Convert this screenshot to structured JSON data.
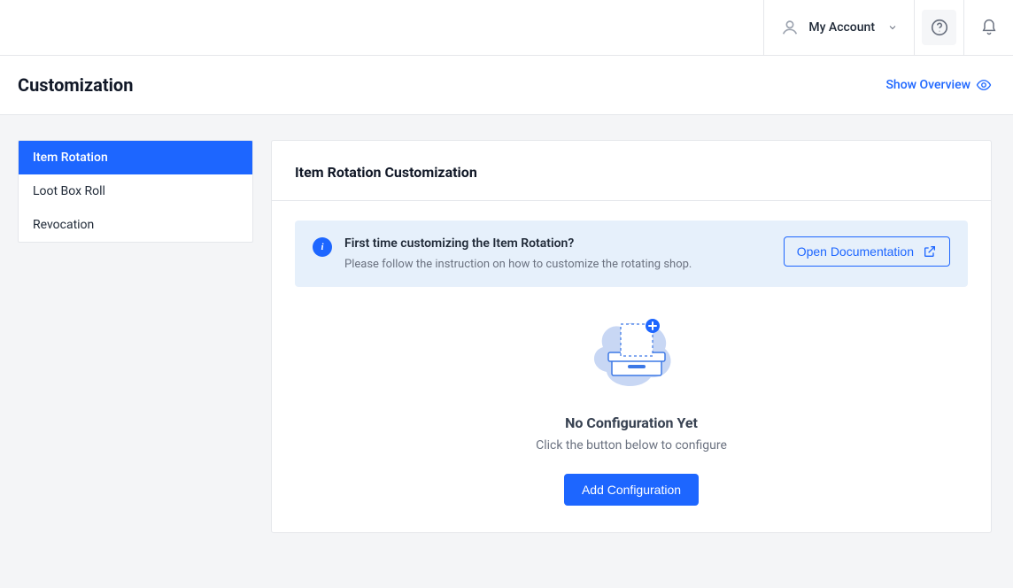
{
  "header": {
    "account_label": "My Account"
  },
  "titlebar": {
    "page_title": "Customization",
    "show_overview_label": "Show Overview"
  },
  "sidebar": {
    "items": [
      {
        "label": "Item Rotation",
        "active": true
      },
      {
        "label": "Loot Box Roll",
        "active": false
      },
      {
        "label": "Revocation",
        "active": false
      }
    ]
  },
  "panel": {
    "title": "Item Rotation Customization",
    "banner": {
      "title": "First time customizing the Item Rotation?",
      "description": "Please follow the instruction on how to customize the rotating shop.",
      "docs_button_label": "Open Documentation"
    },
    "empty_state": {
      "title": "No Configuration Yet",
      "description": "Click the button below to configure",
      "action_label": "Add Configuration"
    }
  },
  "colors": {
    "primary": "#1d66ff",
    "body_bg": "#f4f5f7",
    "banner_bg": "#e6f0fb"
  }
}
